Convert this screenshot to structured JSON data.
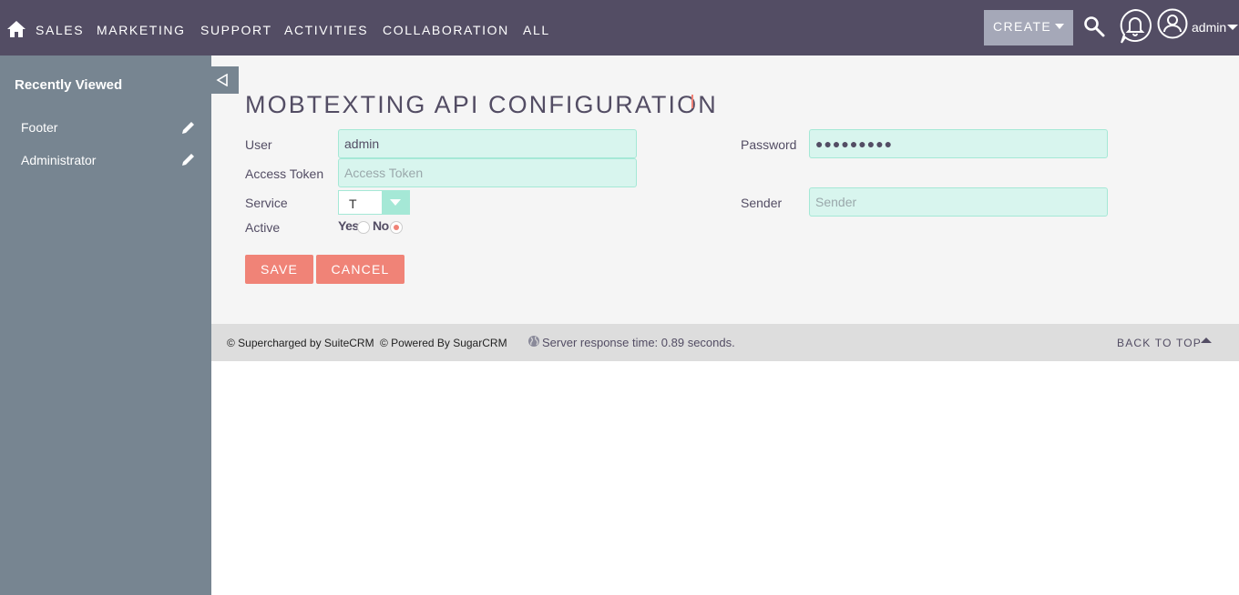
{
  "nav": {
    "items": [
      "SALES",
      "MARKETING",
      "SUPPORT",
      "ACTIVITIES",
      "COLLABORATION",
      "ALL"
    ],
    "create_label": "CREATE",
    "user_label": "admin",
    "icons": [
      "home-icon",
      "search-icon",
      "bell-icon",
      "user-icon"
    ]
  },
  "sidebar": {
    "title": "Recently Viewed",
    "items": [
      {
        "label": "Footer",
        "icon": "pencil-icon"
      },
      {
        "label": "Administrator",
        "icon": "pencil-icon"
      }
    ],
    "collapse_icon": "triangle-left-icon"
  },
  "form": {
    "title": "MOBTEXTING API CONFIGURATION",
    "user_label": "User",
    "user_value": "admin",
    "password_label": "Password",
    "password_value": "●●●●●●●●●",
    "access_token_label": "Access Token",
    "access_token_placeholder": "Access Token",
    "service_label": "Service",
    "service_value": "T",
    "sender_label": "Sender",
    "sender_placeholder": "Sender",
    "active_label": "Active",
    "active_yes": "Yes",
    "active_no": "No",
    "active_selected": "No",
    "save_label": "SAVE",
    "cancel_label": "CANCEL"
  },
  "footer": {
    "supercharged": "© Supercharged by SuiteCRM",
    "powered": "© Powered By SugarCRM",
    "server_time": "Server response time: 0.89 seconds.",
    "back_to_top": "BACK TO TOP"
  },
  "colors": {
    "nav_bg": "#534d64",
    "sidebar_bg": "#778591",
    "accent": "#f08377",
    "input_bg": "#d8f5ee",
    "create_bg": "#a5a8b8"
  }
}
